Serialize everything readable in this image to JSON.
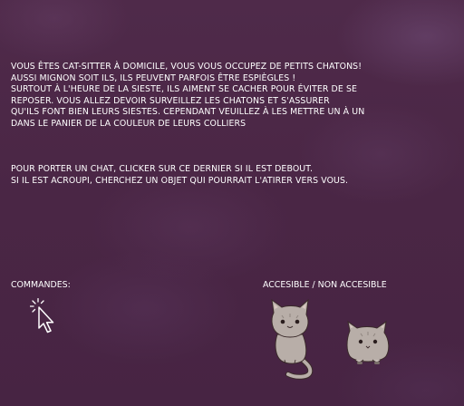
{
  "intro_lines": [
    "VOUS ÊTES CAT-SITTER À DOMICILE, VOUS VOUS OCCUPEZ DE PETITS CHATONS!",
    "AUSSI MIGNON SOIT ILS, ILS PEUVENT PARFOIS ÊTRE ESPIÈGLES !",
    "SURTOUT À L'HEURE DE LA SIESTE, ILS AIMENT SE CACHER POUR ÉVITER DE SE",
    "REPOSER. VOUS ALLEZ DEVOIR SURVEILLEZ LES CHATONS ET S'ASSURER",
    "QU'ILS FONT BIEN LEURS SIESTES. CEPENDANT VEUILLEZ À LES METTRE UN À UN",
    "DANS LE PANIER DE LA COULEUR DE LEURS COLLIERS"
  ],
  "howto_lines": [
    "POUR PORTER UN CHAT, CLICKER SUR CE DERNIER SI IL EST DEBOUT.",
    "SI IL EST ACROUPI, CHERCHEZ UN OBJET QUI POURRAIT L'ATIRER VERS VOUS."
  ],
  "commands_label": "COMMANDES:",
  "access_label": "ACCESIBLE / NON ACCESIBLE",
  "icons": {
    "cursor": "click-cursor-icon",
    "cat_standing": "standing-cat-icon",
    "cat_crouched": "crouched-cat-icon"
  },
  "colors": {
    "background": "#4b2746",
    "text": "#ffffff",
    "cat_fur": "#b8aea8"
  }
}
